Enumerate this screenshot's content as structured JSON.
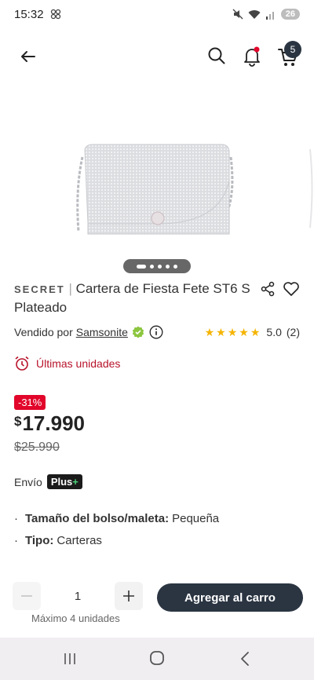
{
  "status": {
    "time": "15:32",
    "battery": "26"
  },
  "header": {
    "cart_count": "5"
  },
  "product": {
    "brand": "SECRET",
    "separator": "|",
    "name": "Cartera de Fiesta Fete ST6 S Plateado",
    "image_dots": 5
  },
  "seller": {
    "label": "Vendido por",
    "name": "Samsonite",
    "rating": "5.0",
    "reviews": "(2)",
    "stars": 5
  },
  "stock": {
    "label": "Últimas unidades"
  },
  "price": {
    "discount": "-31%",
    "currency": "$",
    "current": "17.990",
    "original": "$25.990"
  },
  "shipping": {
    "label": "Envío",
    "badge_text": "Plus",
    "badge_plus": "+"
  },
  "specs": [
    {
      "key": "Tamaño del bolso/maleta:",
      "value": "Pequeña"
    },
    {
      "key": "Tipo:",
      "value": "Carteras"
    }
  ],
  "purchase": {
    "quantity": "1",
    "max_label": "Máximo 4 unidades",
    "add_to_cart_label": "Agregar al carro"
  },
  "colors": {
    "primary_dark": "#2b3542",
    "accent_red": "#e2062b",
    "stock_red": "#b8132b",
    "star_yellow": "#f5b400"
  }
}
